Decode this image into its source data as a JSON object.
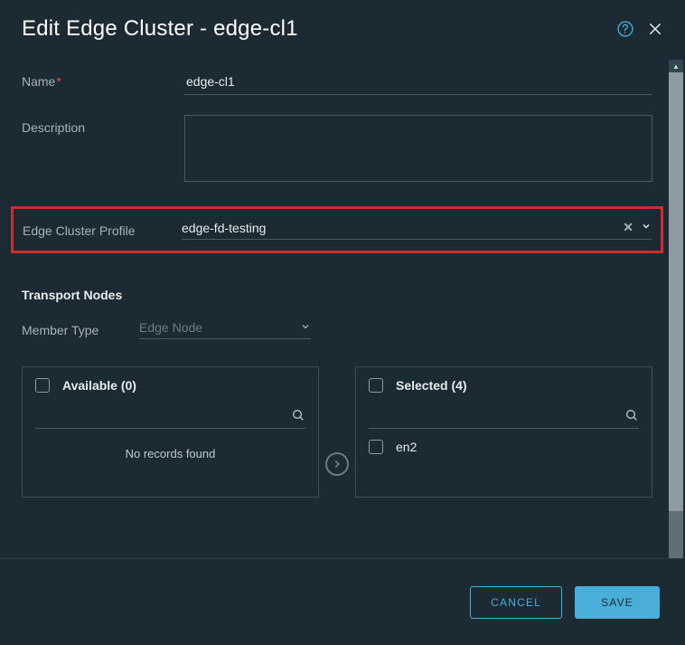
{
  "header": {
    "title": "Edit Edge Cluster - edge-cl1"
  },
  "form": {
    "name_label": "Name",
    "name_value": "edge-cl1",
    "description_label": "Description",
    "description_value": "",
    "profile_label": "Edge Cluster Profile",
    "profile_value": "edge-fd-testing"
  },
  "transport": {
    "heading": "Transport Nodes",
    "member_type_label": "Member Type",
    "member_type_value": "Edge Node",
    "available": {
      "title": "Available (0)",
      "empty_text": "No records found"
    },
    "selected": {
      "title": "Selected (4)",
      "items": [
        "en2"
      ]
    }
  },
  "footer": {
    "cancel": "CANCEL",
    "save": "SAVE"
  }
}
